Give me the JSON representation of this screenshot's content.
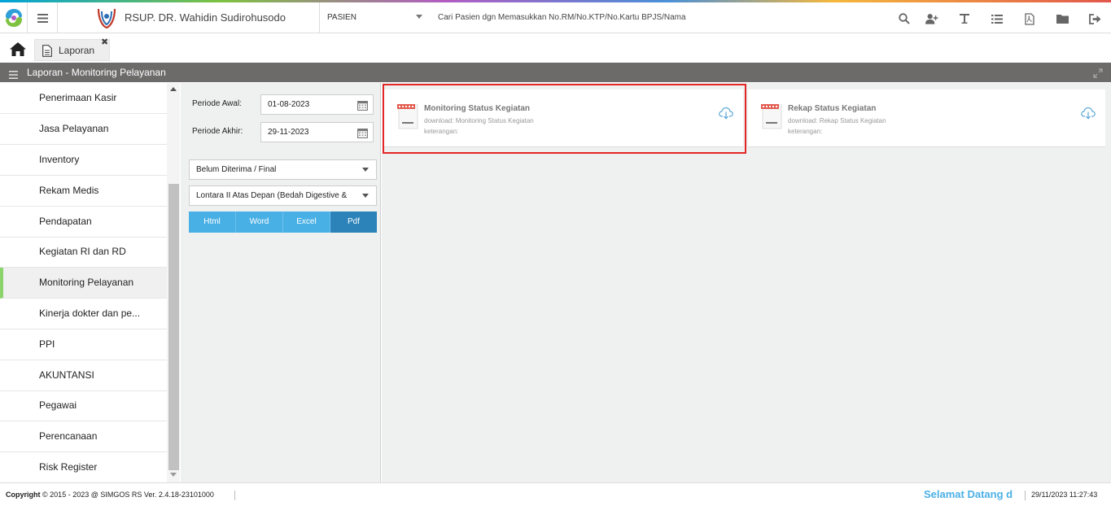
{
  "app": {
    "hospital_name": "RSUP. DR. Wahidin Sudirohusodo"
  },
  "search": {
    "type": "PASIEN",
    "placeholder": "Cari Pasien dgn Memasukkan No.RM/No.KTP/No.Kartu BPJS/Nama"
  },
  "toolbar": {
    "icons": [
      "search-icon",
      "user-plus-icon",
      "text-icon",
      "list-icon",
      "pdf-icon",
      "folder-icon",
      "logout-icon"
    ]
  },
  "tabs": [
    {
      "label": "Laporan",
      "close": "✖"
    }
  ],
  "panel": {
    "title": "Laporan - Monitoring Pelayanan"
  },
  "sidebar": {
    "items": [
      {
        "label": "Penerimaan Kasir"
      },
      {
        "label": "Jasa Pelayanan"
      },
      {
        "label": "Inventory"
      },
      {
        "label": "Rekam Medis"
      },
      {
        "label": "Pendapatan"
      },
      {
        "label": "Kegiatan RI dan RD"
      },
      {
        "label": "Monitoring Pelayanan"
      },
      {
        "label": "Kinerja dokter dan pe..."
      },
      {
        "label": "PPI"
      },
      {
        "label": "AKUNTANSI"
      },
      {
        "label": "Pegawai"
      },
      {
        "label": "Perencanaan"
      },
      {
        "label": "Risk Register"
      }
    ],
    "active_index": 6
  },
  "form": {
    "periode_awal_label": "Periode Awal:",
    "periode_awal_value": "01-08-2023",
    "periode_akhir_label": "Periode Akhir:",
    "periode_akhir_value": "29-11-2023",
    "status_select": "Belum Diterima / Final",
    "ruangan_select": "Lontara II Atas Depan (Bedah Digestive &",
    "formats": [
      "Html",
      "Word",
      "Excel",
      "Pdf"
    ],
    "selected_format": "Pdf"
  },
  "reports": [
    {
      "title": "Monitoring Status Kegiatan",
      "download": "download: Monitoring Status Kegiatan",
      "note": "keterangan:"
    },
    {
      "title": "Rekap Status Kegiatan",
      "download": "download: Rekap Status Kegiatan",
      "note": "keterangan:"
    }
  ],
  "footer": {
    "copyright_bold": "Copyright",
    "copyright_symbol": "©",
    "copyright_text": "2015 - 2023 @ SIMGOS RS Ver. 2.4.18-23101000",
    "welcome": "Selamat Datang d",
    "datetime": "29/11/2023 11:27:43"
  },
  "colors": {
    "accent": "#49b0e5",
    "accent_dark": "#2b83b9",
    "panel_header": "#6d6a6a",
    "active_marker": "#8bd46b",
    "highlight": "#e32727"
  }
}
